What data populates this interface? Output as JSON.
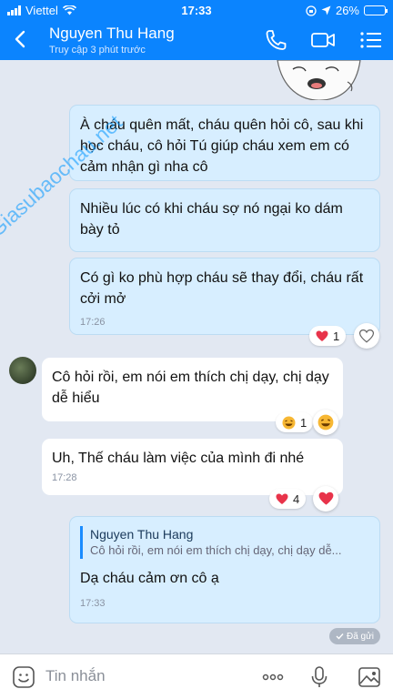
{
  "status_bar": {
    "carrier": "Viettel",
    "time": "17:33",
    "battery": "26%",
    "battery_level": 0.26
  },
  "header": {
    "contact_name": "Nguyen Thu Hang",
    "last_seen": "Truy cập 3 phút trước"
  },
  "watermark": "Giasubaochau.net",
  "messages": [
    {
      "id": "m1",
      "side": "me",
      "text": "À cháu quên mất, cháu quên hỏi cô, sau khi học cháu, cô hỏi Tú giúp cháu xem em có cảm nhận gì nha cô"
    },
    {
      "id": "m2",
      "side": "me",
      "text": "Nhiều lúc có khi cháu sợ nó ngại ko dám bày tỏ"
    },
    {
      "id": "m3",
      "side": "me",
      "text": "Có gì ko phù hợp cháu sẽ thay đổi, cháu rất cởi mở",
      "time": "17:26",
      "reaction_count": "1"
    },
    {
      "id": "m4",
      "side": "them",
      "text": "Cô hỏi rồi, em nói em thích chị dạy, chị dạy dễ hiểu",
      "reaction_count": "1"
    },
    {
      "id": "m5",
      "side": "them",
      "text": "Uh, Thế cháu làm việc của mình đi nhé",
      "time": "17:28",
      "reaction_count": "4"
    },
    {
      "id": "m6",
      "side": "me",
      "quote_name": "Nguyen Thu Hang",
      "quote_text": "Cô hỏi rồi, em nói em thích chị dạy, chị dạy dễ...",
      "text": "Dạ cháu cảm ơn cô ạ",
      "time": "17:33"
    }
  ],
  "delivered_label": "Đã gửi",
  "input": {
    "placeholder": "Tin nhắn"
  },
  "colors": {
    "accent": "#0b84fe",
    "outgoing_bubble": "#d7eeff",
    "background": "#e2e8f2",
    "heart": "#e8334a"
  }
}
